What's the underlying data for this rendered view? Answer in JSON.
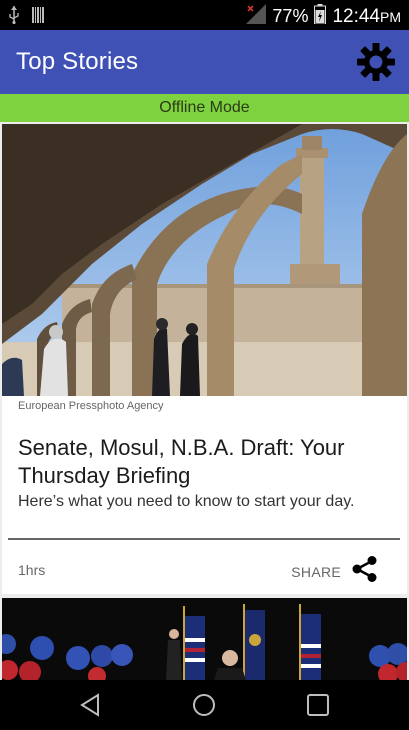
{
  "status_bar": {
    "battery_percent": "77%",
    "time": "12:44",
    "ampm": "PM",
    "icons": [
      "usb-icon",
      "barcode-icon",
      "signal-icon",
      "battery-icon"
    ]
  },
  "app_bar": {
    "title": "Top Stories",
    "settings_icon": "gear-icon"
  },
  "banner": {
    "text": "Offline Mode",
    "color": "#7ed23f"
  },
  "story": {
    "image_credit": "European Pressphoto Agency",
    "headline": "Senate, Mosul, N.B.A. Draft: Your Thursday Briefing",
    "summary": "Here’s what you need to know to start your day.",
    "age": "1hrs",
    "share_label": "SHARE",
    "share_icon": "share-icon"
  },
  "navigation": {
    "back_icon": "back-icon",
    "home_icon": "home-icon",
    "recents_icon": "recents-icon"
  },
  "colors": {
    "app_bar": "#3f51b5",
    "offline_banner": "#7ed23f"
  }
}
